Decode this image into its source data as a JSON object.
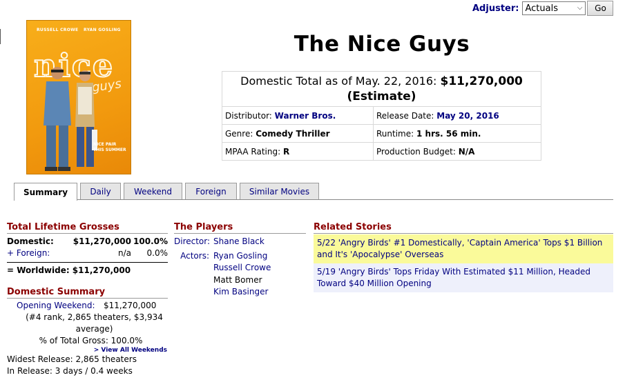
{
  "adjuster": {
    "label": "Adjuster:",
    "selected": "Actuals",
    "go_label": "Go"
  },
  "poster": {
    "actor1": "RUSSELL CROWE",
    "actor2": "RYAN GOSLING",
    "title": "nice",
    "subtitle": "guys",
    "tagline1": "NICE PAIR",
    "tagline2": "THIS SUMMER",
    "colors": {
      "background": "#f29a0e",
      "accent": "#ffffff"
    }
  },
  "movie": {
    "title": "The Nice Guys"
  },
  "summary": {
    "total_label": "Domestic Total as of May. 22, 2016:",
    "total_value": "$11,270,000",
    "total_note": "(Estimate)",
    "distributor_label": "Distributor:",
    "distributor": "Warner Bros.",
    "release_label": "Release Date:",
    "release": "May 20, 2016",
    "genre_label": "Genre:",
    "genre": "Comedy Thriller",
    "runtime_label": "Runtime:",
    "runtime": "1 hrs. 56 min.",
    "mpaa_label": "MPAA Rating:",
    "mpaa": "R",
    "budget_label": "Production Budget:",
    "budget": "N/A"
  },
  "tabs": [
    "Summary",
    "Daily",
    "Weekend",
    "Foreign",
    "Similar Movies"
  ],
  "grosses": {
    "heading": "Total Lifetime Grosses",
    "domestic": {
      "label": "Domestic:",
      "value": "$11,270,000",
      "pct": "100.0%"
    },
    "foreign": {
      "label": "+ Foreign:",
      "value": "n/a",
      "pct": "0.0%"
    },
    "worldwide": "= Worldwide: $11,270,000"
  },
  "domestic_summary": {
    "heading": "Domestic Summary",
    "opening_label": "Opening Weekend:",
    "opening_value": "$11,270,000",
    "opening_detail": "(#4 rank, 2,865 theaters, $3,934 average)",
    "pct_total": "% of Total Gross: 100.0%",
    "view_all": "> View All Weekends",
    "widest": "Widest Release: 2,865 theaters",
    "in_release": "In Release: 3 days / 0.4 weeks"
  },
  "players": {
    "heading": "The Players",
    "director_label": "Director:",
    "director": "Shane Black",
    "actors_label": "Actors:",
    "actors": [
      "Ryan Gosling",
      "Russell Crowe",
      "Matt Bomer",
      "Kim Basinger"
    ]
  },
  "stories": {
    "heading": "Related Stories",
    "items": [
      "5/22 'Angry Birds' #1 Domestically, 'Captain America' Tops $1 Billion and It's 'Apocalypse' Overseas",
      "5/19 'Angry Birds' Tops Friday With Estimated $11 Million, Headed Toward $40 Million Opening"
    ]
  }
}
